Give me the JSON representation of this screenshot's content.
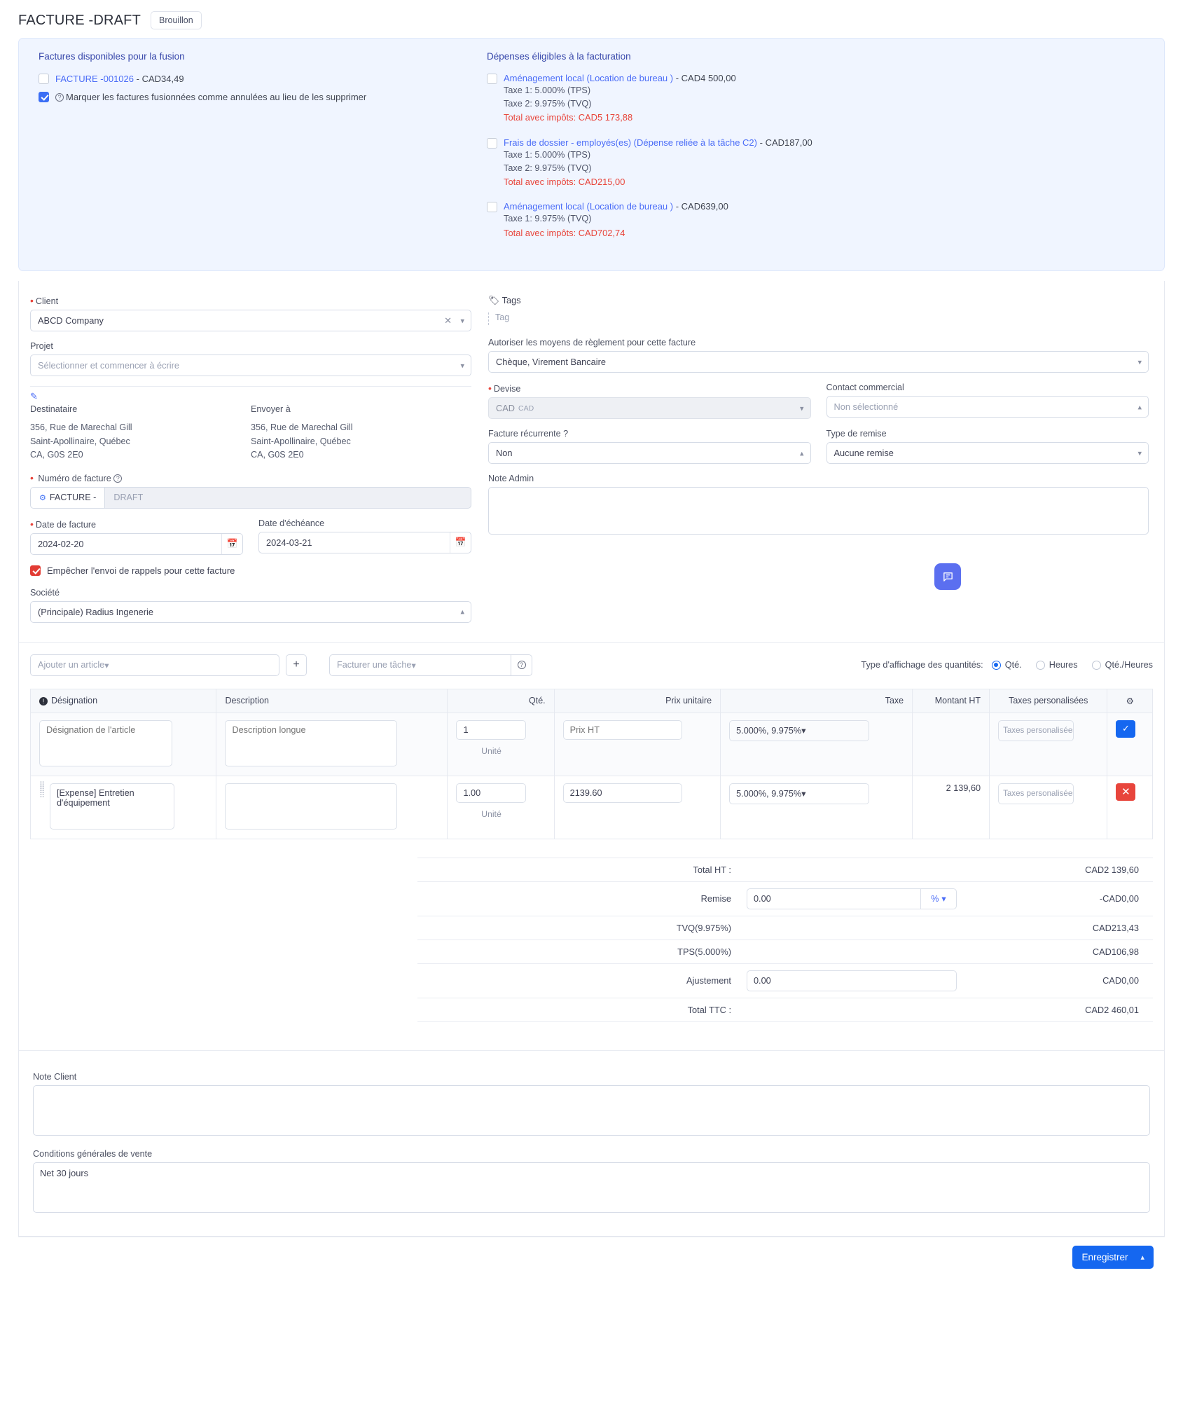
{
  "header": {
    "title": "FACTURE -DRAFT",
    "status": "Brouillon"
  },
  "merge": {
    "heading": "Factures disponibles pour la fusion",
    "invoices": [
      {
        "label": "FACTURE -001026",
        "amount": "- CAD34,49",
        "checked": false
      }
    ],
    "cancel_option": {
      "label": "Marquer les factures fusionnées comme annulées au lieu de les supprimer",
      "checked": true
    }
  },
  "expenses": {
    "heading": "Dépenses éligibles à la facturation",
    "items": [
      {
        "label": "Aménagement local (Location de bureau )",
        "amount": "- CAD4 500,00",
        "tax1": "Taxe 1: 5.000% (TPS)",
        "tax2": "Taxe 2: 9.975% (TVQ)",
        "total": "Total avec impôts: CAD5 173,88",
        "checked": false
      },
      {
        "label": "Frais de dossier - employés(es) (Dépense reliée à la tâche C2)",
        "amount": "- CAD187,00",
        "tax1": "Taxe 1: 5.000% (TPS)",
        "tax2": "Taxe 2: 9.975% (TVQ)",
        "total": "Total avec impôts: CAD215,00",
        "checked": false
      },
      {
        "label": "Aménagement local (Location de bureau )",
        "amount": "- CAD639,00",
        "tax1": "Taxe 1: 9.975% (TVQ)",
        "tax2": "",
        "total": "Total avec impôts: CAD702,74",
        "checked": false
      }
    ]
  },
  "form": {
    "client_label": "Client",
    "client_value": "ABCD Company",
    "projet_label": "Projet",
    "projet_placeholder": "Sélectionner et commencer à écrire",
    "destinataire_label": "Destinataire",
    "envoyer_label": "Envoyer à",
    "address": {
      "l1": "356, Rue de Marechal Gill",
      "l2": "Saint-Apollinaire, Québec",
      "l3": "CA, G0S 2E0"
    },
    "numero_label": "Numéro de facture",
    "numero_prefix": "FACTURE -",
    "numero_value": "DRAFT",
    "date_facture_label": "Date de facture",
    "date_facture_value": "2024-02-20",
    "date_echeance_label": "Date d'échéance",
    "date_echeance_value": "2024-03-21",
    "reminder_label": "Empêcher l'envoi de rappels pour cette facture",
    "reminder_checked": true,
    "societe_label": "Société",
    "societe_value": "(Principale) Radius Ingenerie",
    "tags_label": "Tags",
    "tag_placeholder": "Tag",
    "payment_label": "Autoriser les moyens de règlement pour cette facture",
    "payment_value": "Chèque, Virement Bancaire",
    "devise_label": "Devise",
    "devise_value": "CAD",
    "devise_code": "CAD",
    "contact_label": "Contact commercial",
    "contact_placeholder": "Non sélectionné",
    "recurrente_label": "Facture récurrente ?",
    "recurrente_value": "Non",
    "remise_type_label": "Type de remise",
    "remise_type_value": "Aucune remise",
    "note_admin_label": "Note Admin",
    "note_admin_value": ""
  },
  "items_toolbar": {
    "add_article_placeholder": "Ajouter un article",
    "add_button": "+",
    "task_placeholder": "Facturer une tâche",
    "qty_type_label": "Type d'affichage des quantités:",
    "qty_options": [
      {
        "label": "Qté.",
        "selected": true
      },
      {
        "label": "Heures",
        "selected": false
      },
      {
        "label": "Qté./Heures",
        "selected": false
      }
    ]
  },
  "items_table": {
    "columns": [
      "Désignation",
      "Description",
      "Qté.",
      "Prix unitaire",
      "Taxe",
      "Montant HT",
      "Taxes personalisées",
      "gear-icon"
    ],
    "unit_label": "Unité",
    "new_row": {
      "designation_placeholder": "Désignation de l'article",
      "description_placeholder": "Description longue",
      "qty": "1",
      "price_placeholder": "Prix HT",
      "tax": "5.000%, 9.975%",
      "amount": "",
      "custom_tax_placeholder": "Taxes personalisées"
    },
    "rows": [
      {
        "designation": "[Expense] Entretien d'équipement",
        "description": "",
        "qty": "1.00",
        "price": "2139.60",
        "tax": "5.000%, 9.975%",
        "amount": "2 139,60",
        "custom_tax_placeholder": "Taxes personalisées"
      }
    ]
  },
  "totals": {
    "total_ht_label": "Total HT :",
    "total_ht_value": "CAD2 139,60",
    "remise_label": "Remise",
    "remise_input": "0.00",
    "remise_unit": "%",
    "remise_value": "-CAD0,00",
    "tvq_label": "TVQ(9.975%)",
    "tvq_value": "CAD213,43",
    "tps_label": "TPS(5.000%)",
    "tps_value": "CAD106,98",
    "ajustement_label": "Ajustement",
    "ajustement_input": "0.00",
    "ajustement_value": "CAD0,00",
    "total_ttc_label": "Total TTC :",
    "total_ttc_value": "CAD2 460,01"
  },
  "notes": {
    "note_client_label": "Note Client",
    "note_client_value": "",
    "cgv_label": "Conditions générales de vente",
    "cgv_value": "Net 30 jours"
  },
  "footer": {
    "save_label": "Enregistrer"
  },
  "colors": {
    "accent": "#1567f0",
    "link": "#4a6cf7",
    "danger": "#e8453c",
    "panel": "#f0f5ff",
    "heading": "#3949ab"
  }
}
